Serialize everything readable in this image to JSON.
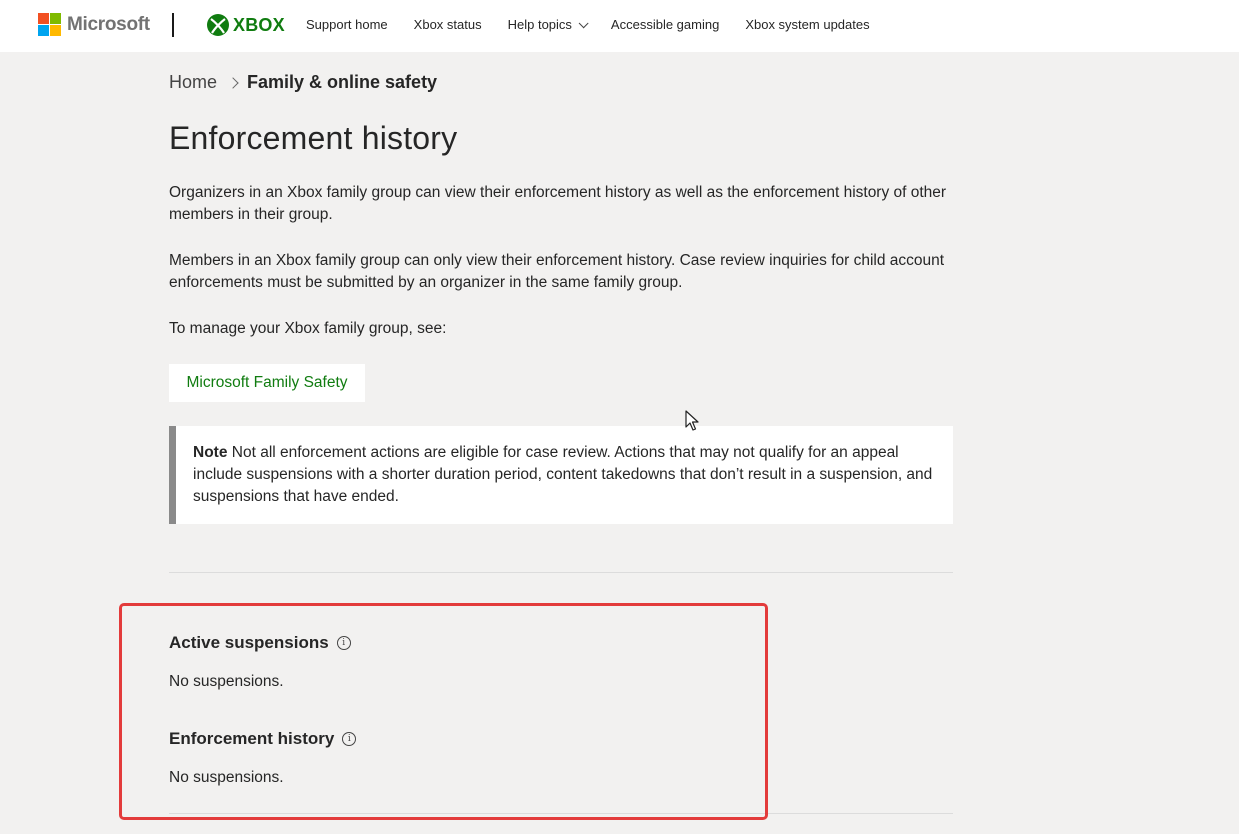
{
  "header": {
    "brand": "Microsoft",
    "product": "XBOX",
    "nav": [
      {
        "label": "Support home"
      },
      {
        "label": "Xbox status"
      },
      {
        "label": "Help topics"
      },
      {
        "label": "Accessible gaming"
      },
      {
        "label": "Xbox system updates"
      }
    ],
    "colors": {
      "microsoft_red": "#f25022",
      "microsoft_green": "#7fba00",
      "microsoft_blue": "#00a4ef",
      "microsoft_yellow": "#ffb900",
      "xbox_green": "#107c10"
    }
  },
  "breadcrumb": {
    "home": "Home",
    "current": "Family & online safety"
  },
  "main": {
    "title": "Enforcement history",
    "paragraphs": [
      "Organizers in an Xbox family group can view their enforcement history as well as the enforcement history of other members in their group.",
      "Members in an Xbox family group can only view their enforcement history. Case review inquiries for child account enforcements must be submitted by an organizer in the same family group.",
      "To manage your Xbox family group, see:"
    ],
    "family_button": "Microsoft Family Safety",
    "note": {
      "label": "Note",
      "text": "Not all enforcement actions are eligible for case review. Actions that may not qualify for an appeal include suspensions with a shorter duration period, content takedowns that don’t result in a suspension, and suspensions that have ended."
    }
  },
  "sections": {
    "active": {
      "title": "Active suspensions",
      "text": "No suspensions.",
      "icon": "info-icon"
    },
    "history": {
      "title": "Enforcement history",
      "text": "No suspensions.",
      "icon": "info-icon"
    }
  },
  "highlight_color": "#e33b3b"
}
